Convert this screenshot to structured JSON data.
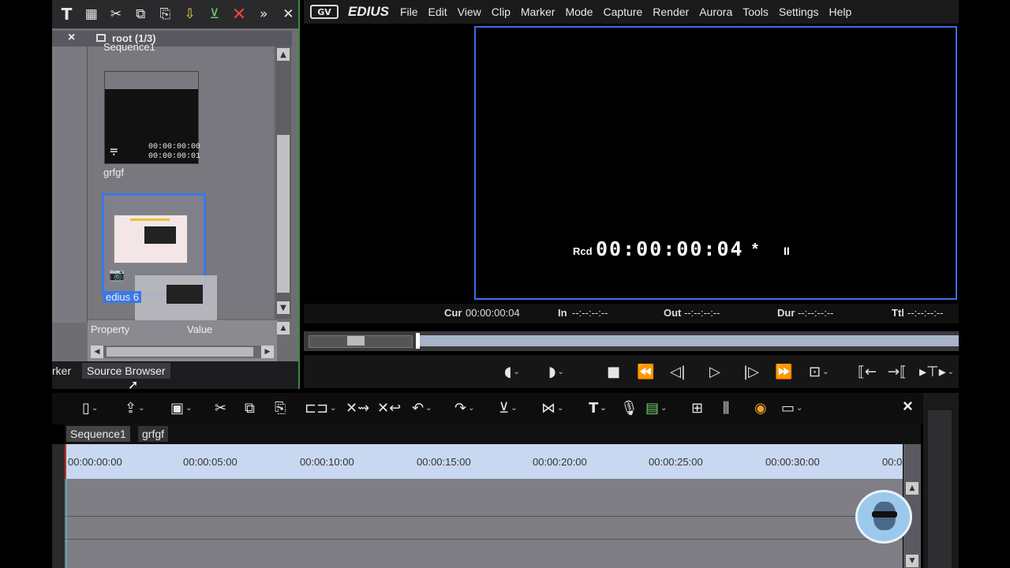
{
  "bin": {
    "close_label": "×",
    "root_label": "root (1/3)",
    "clips": [
      {
        "name": "Sequence1",
        "tc1": "00:00:00:00",
        "tc2": "00:00:00:01"
      },
      {
        "name": "grfgf"
      },
      {
        "name": "edius 6"
      }
    ],
    "property_header": "Property",
    "value_header": "Value",
    "tabs": [
      "rker",
      "Source Browser"
    ]
  },
  "app": {
    "logo": "EDIUS",
    "menu": [
      "File",
      "Edit",
      "View",
      "Clip",
      "Marker",
      "Mode",
      "Capture",
      "Render",
      "Aurora",
      "Tools",
      "Settings",
      "Help"
    ]
  },
  "monitor": {
    "rcd_label": "Rcd",
    "timecode": "00:00:00:04",
    "timecode_suffix": "*",
    "pause_symbol": "II",
    "cur_label": "Cur",
    "cur_value": "00:00:00:04",
    "in_label": "In",
    "in_value": "--:--:--:--",
    "out_label": "Out",
    "out_value": "--:--:--:--",
    "dur_label": "Dur",
    "dur_value": "--:--:--:--",
    "ttl_label": "Ttl",
    "ttl_value": "--:--:--:--"
  },
  "timeline": {
    "tabs": [
      "Sequence1",
      "grfgf"
    ],
    "ruler": [
      "00:00:00:00",
      "00:00:05:00",
      "00:00:10:00",
      "00:00:15:00",
      "00:00:20:00",
      "00:00:25:00",
      "00:00:30:00",
      "00:0"
    ],
    "close_label": "×"
  }
}
